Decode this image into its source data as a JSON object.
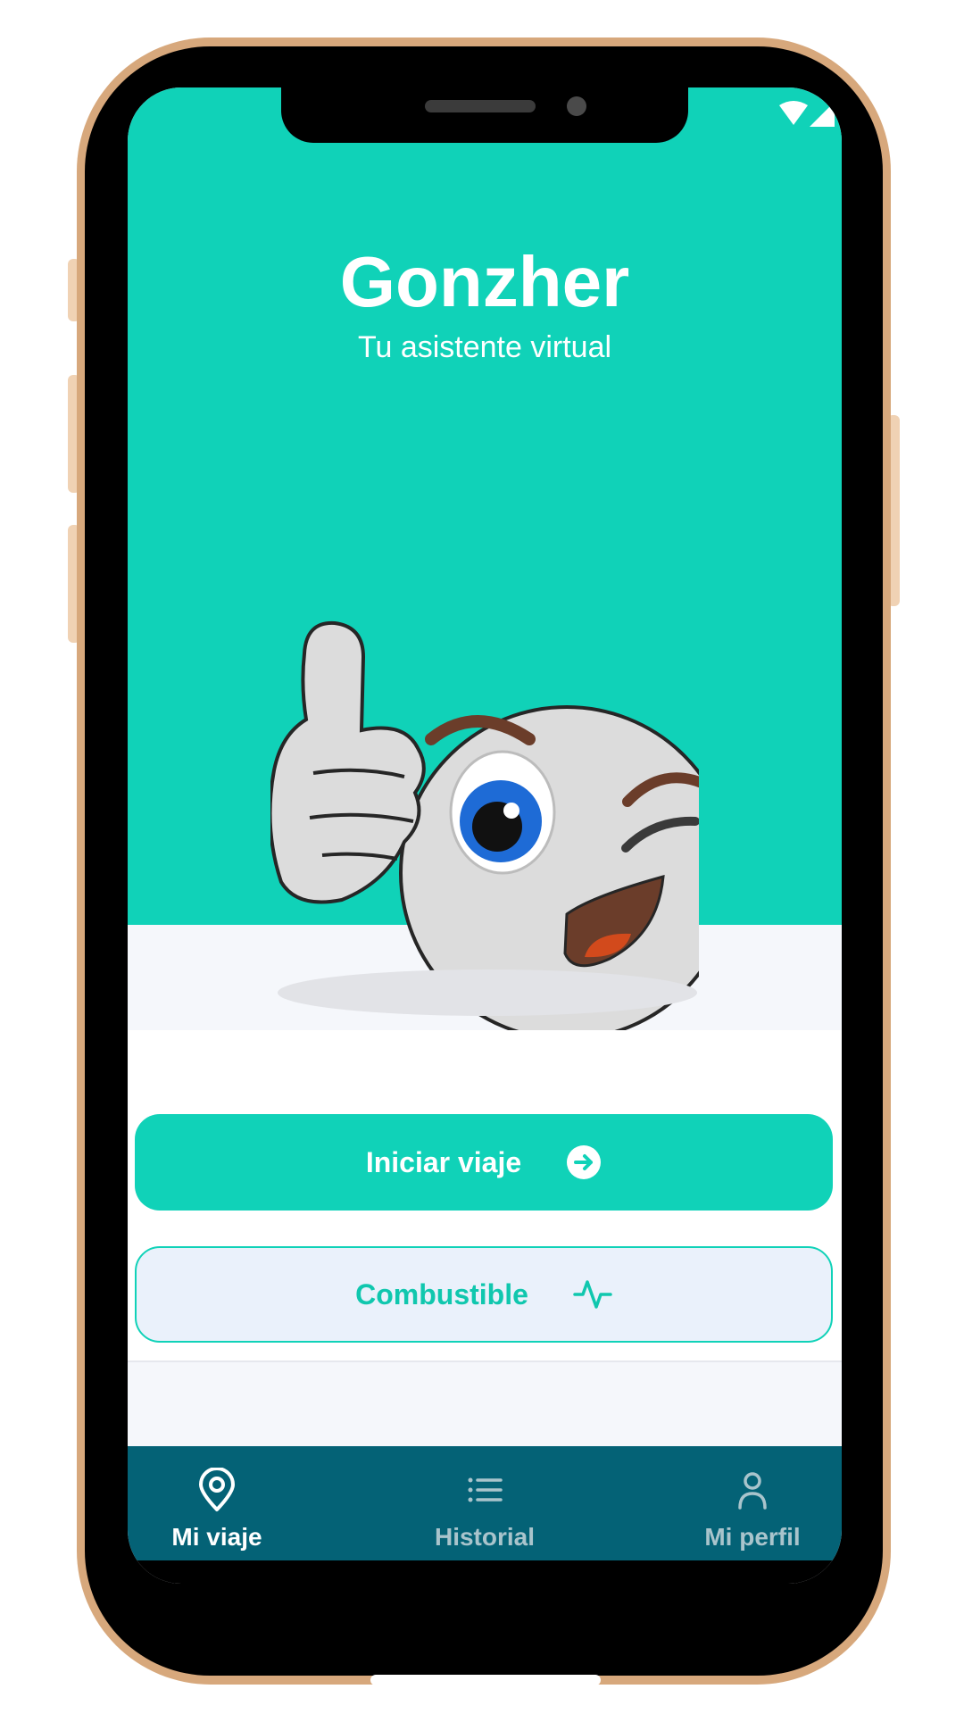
{
  "app": {
    "title": "Gonzher",
    "subtitle": "Tu asistente virtual"
  },
  "actions": {
    "start_trip_label": "Iniciar viaje",
    "start_trip_icon": "arrow-right-circle-icon",
    "fuel_label": "Combustible",
    "fuel_icon": "activity-icon"
  },
  "bottom_nav": {
    "items": [
      {
        "label": "Mi viaje",
        "icon": "location-pin-icon",
        "active": true
      },
      {
        "label": "Historial",
        "icon": "list-icon",
        "active": false
      },
      {
        "label": "Mi perfil",
        "icon": "person-icon",
        "active": false
      }
    ]
  },
  "colors": {
    "accent": "#10d2b8",
    "nav_background": "#046276",
    "frame": "#d7a87c"
  }
}
